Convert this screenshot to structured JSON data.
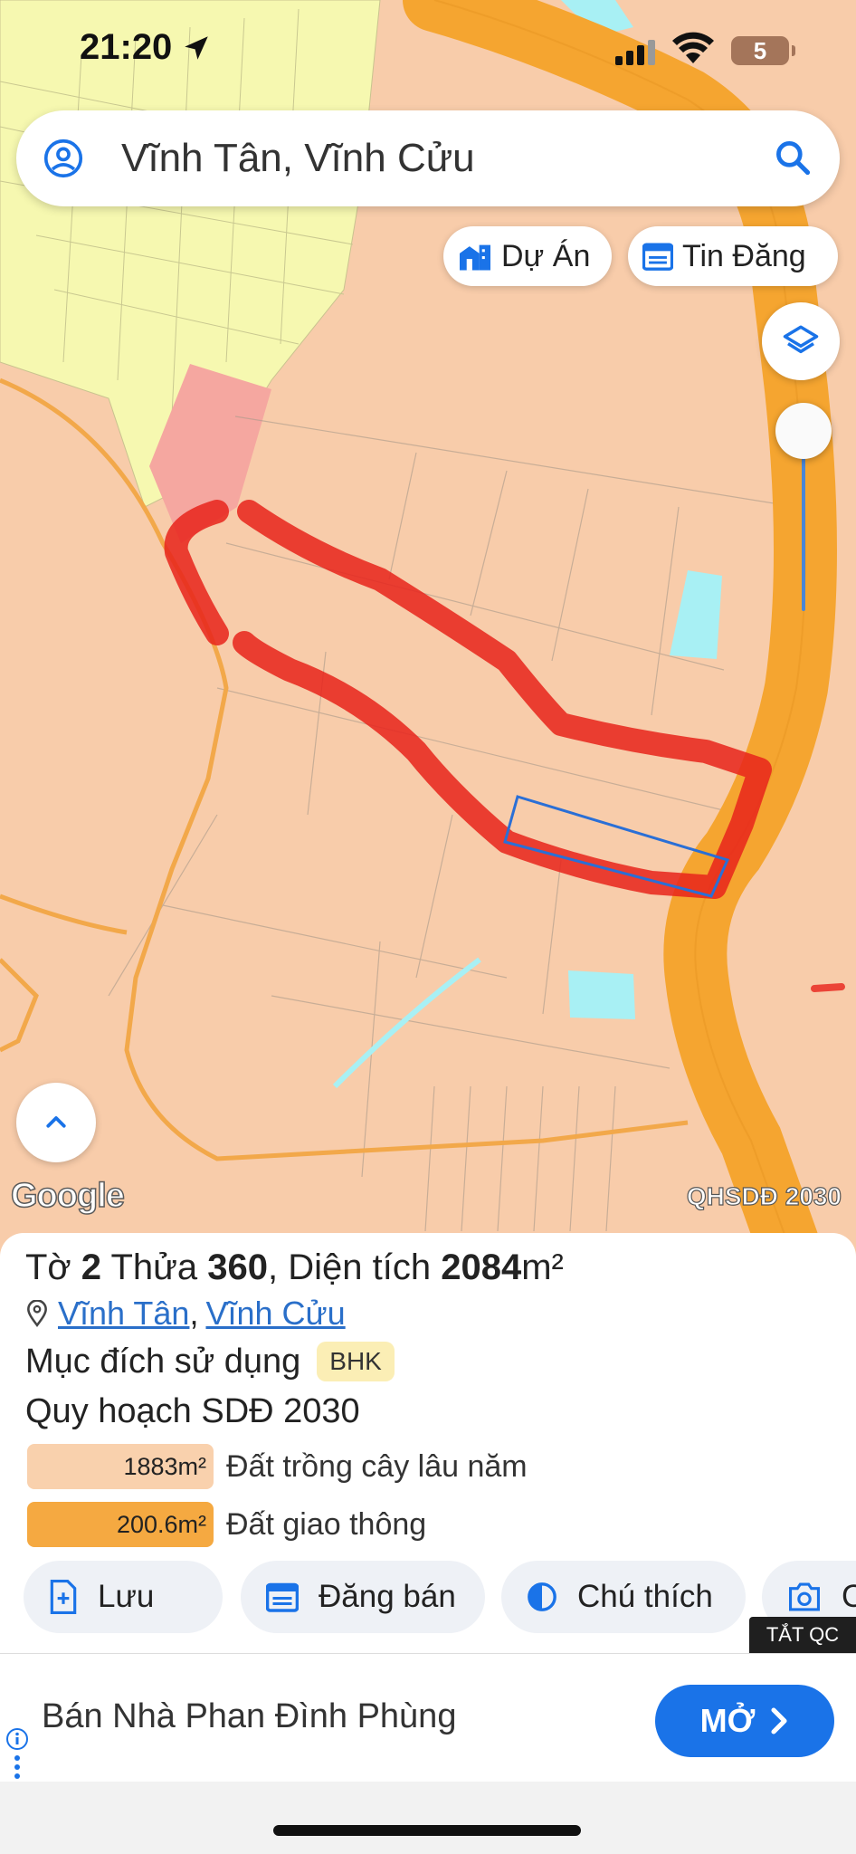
{
  "status_bar": {
    "time": "21:20",
    "battery": "5"
  },
  "search": {
    "query": "Vĩnh Tân, Vĩnh Cửu"
  },
  "map_chips": {
    "du_an": "Dự Án",
    "tin_dang": "Tin Đăng"
  },
  "map": {
    "attribution": "Google",
    "layer_label": "QHSDĐ 2030"
  },
  "parcel": {
    "to_label": "Tờ",
    "to_number": "2",
    "thua_label": "Thửa",
    "thua_number": "360",
    "dien_tich_label": ", Diện tích",
    "area": "2084",
    "area_unit": "m²",
    "ward": "Vĩnh Tân",
    "location_separator": ",",
    "district": "Vĩnh Cửu",
    "purpose_label": "Mục đích sử dụng",
    "purpose_code": "BHK",
    "plan_label": "Quy hoạch SDĐ 2030",
    "land_uses": [
      {
        "area": "1883m²",
        "name": "Đất trồng cây lâu năm",
        "color": "#f9d1ad"
      },
      {
        "area": "200.6m²",
        "name": "Đất giao thông",
        "color": "#f5a941"
      }
    ]
  },
  "actions": {
    "save": "Lưu",
    "post_sale": "Đăng bán",
    "legend": "Chú thích",
    "more": "C"
  },
  "ad": {
    "close_label": "TẮT QC",
    "text": "Bán Nhà Phan Đình Phùng",
    "open_label": "MỞ"
  },
  "colors": {
    "map_land": "#f8ccaa",
    "map_road": "#f5a530",
    "map_farmland": "#f6f8b0",
    "map_water": "#a8f0f4",
    "highlight": "#e8231b",
    "accent": "#1a73e8"
  }
}
